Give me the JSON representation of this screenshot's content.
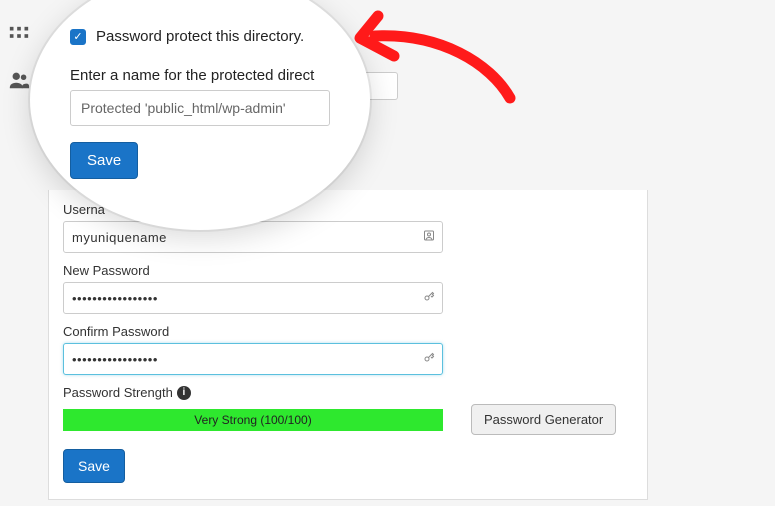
{
  "magnifier": {
    "checkbox_checked": true,
    "checkbox_label": "Password protect this directory.",
    "directory_label": "Enter a name for the protected direct",
    "directory_value": "Protected 'public_html/wp-admin'",
    "save_label": "Save"
  },
  "form": {
    "username_label": "Userna",
    "username_value": "myuniquename",
    "new_password_label": "New Password",
    "new_password_value": "•••••••••••••••••",
    "confirm_password_label": "Confirm Password",
    "confirm_password_value": "•••••••••••••••••",
    "strength_label": "Password Strength",
    "strength_text": "Very Strong (100/100)",
    "generator_label": "Password Generator",
    "save_label": "Save"
  },
  "icons": {
    "grid": "grid-icon",
    "users": "users-icon",
    "contact": "contact-icon",
    "key": "key-icon",
    "info": "i"
  }
}
